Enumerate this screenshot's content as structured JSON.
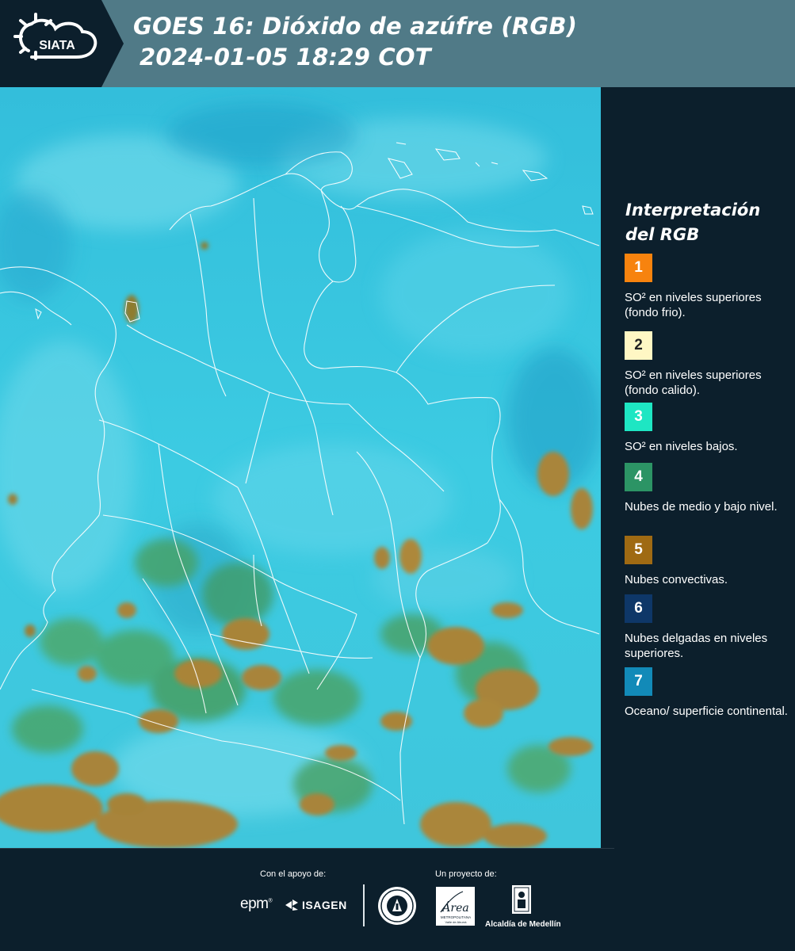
{
  "header": {
    "logo_text": "SIATA",
    "title": "GOES 16: Dióxido de azúfre (RGB)",
    "datetime": "2024-01-05 18:29 COT"
  },
  "legend": {
    "title": "Interpretación del RGB",
    "items": [
      {
        "number": "1",
        "label": "SO² en niveles superiores (fondo frio).",
        "color": "#f7830e"
      },
      {
        "number": "2",
        "label": "SO² en niveles superiores (fondo calido).",
        "color": "#fff7c4"
      },
      {
        "number": "3",
        "label": "SO² en niveles bajos.",
        "color": "#1ee6c3"
      },
      {
        "number": "4",
        "label": "Nubes de medio y bajo nivel.",
        "color": "#2c9465"
      },
      {
        "number": "5",
        "label": "Nubes convectivas.",
        "color": "#9f6a13"
      },
      {
        "number": "6",
        "label": "Nubes delgadas en niveles superiores.",
        "color": "#0e3768"
      },
      {
        "number": "7",
        "label": "Oceano/ superficie continental.",
        "color": "#128ab8"
      }
    ]
  },
  "footer": {
    "support_caption": "Con el apoyo de:",
    "project_caption": "Un proyecto de:",
    "sponsors": [
      "epm",
      "ISAGEN"
    ],
    "project_logos": {
      "area": "Área",
      "area_subtitle": "METROPOLITANA",
      "area_tagline": "Valle de Aburrá",
      "alcaldia": "Alcaldía de Medellín"
    }
  },
  "colors": {
    "header_bg": "#507a87",
    "panel_bg": "#0c1f2c",
    "map_background": "#35c3dd",
    "convective_cloud": "#a8843a",
    "mid_cloud": "#4aa86a"
  }
}
